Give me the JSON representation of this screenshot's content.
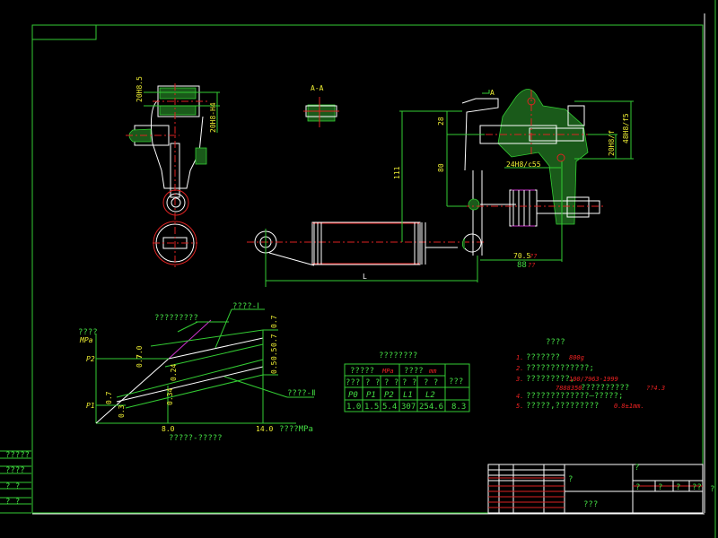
{
  "drawing": {
    "section_label": "A-A",
    "dims": {
      "left_top": "20H8.5",
      "left_side": "20H8-H4",
      "d28": "28",
      "d80": "80",
      "d111": "111",
      "hole": "24H8/c55",
      "right_outer": "48H8/f5",
      "right_inner": "20H8/f",
      "d70": "70.5",
      "d70_tol": "??",
      "d88": "88",
      "d88_tol": "??",
      "length": "L",
      "arrow_label": "A"
    }
  },
  "chart": {
    "title_line": "?????????",
    "label_upper": "????-Ⅰ",
    "label_lower": "????-Ⅱ",
    "y_label": "????",
    "y_unit": "MPa",
    "p2": "P2",
    "p1": "P1",
    "x_tick_1": "8.0",
    "x_tick_2": "14.0",
    "x_label": "????MPa",
    "x_title": "?????-?????",
    "ann": [
      "0.7",
      "7.0",
      "0.7",
      "0.3",
      "0.34",
      "0.24",
      "0.7",
      "0.7",
      "0.5",
      "0.5"
    ]
  },
  "spec_table": {
    "title": "????????",
    "group1": "?????",
    "group1_unit": "MPa",
    "group2": "????",
    "group2_unit": "mm",
    "last_header": "???",
    "subheaders": [
      "???",
      "? ?",
      "? ?",
      "? ?",
      "? ?"
    ],
    "symbols": [
      "P0",
      "P1",
      "P2",
      "L1",
      "L2"
    ],
    "values": [
      "1.0",
      "1.5",
      "5.4",
      "307",
      "254.6",
      "8.3"
    ]
  },
  "notes": {
    "title": "????",
    "items": [
      {
        "num": "1.",
        "text": "???????",
        "red": "800g"
      },
      {
        "num": "2.",
        "text": "?????????????;",
        "red": ""
      },
      {
        "num": "3.",
        "text": "?????????,",
        "red": "100/7963-1999"
      },
      {
        "num": "",
        "text": "??????????",
        "red": "7888350",
        "tail": "??4.3"
      },
      {
        "num": "4.",
        "text": "?????????????—?????;",
        "red": ""
      },
      {
        "num": "5.",
        "text": "?????,?????????",
        "red": "0.8±1mm."
      }
    ]
  },
  "title_block": {
    "name": "???",
    "q1": "?",
    "q2": "?",
    "scale_cells": [
      "?",
      "?",
      "?",
      "??"
    ],
    "side_mark": "?"
  },
  "left_strip": {
    "rows": [
      "?????",
      "????",
      "? ?",
      "? ?"
    ]
  }
}
